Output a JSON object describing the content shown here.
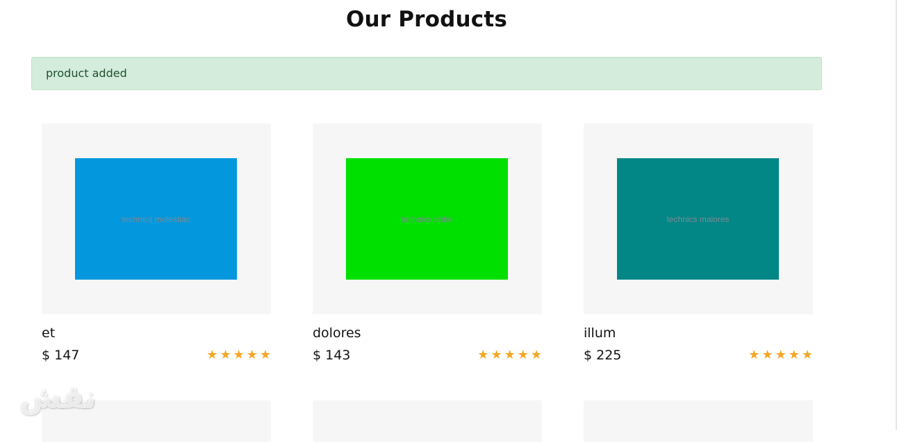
{
  "page": {
    "title": "Our Products"
  },
  "alert": {
    "message": "product added"
  },
  "products": [
    {
      "name": "et",
      "price": "$ 147",
      "image_text": "technics molestias",
      "image_color": "#0397dd",
      "rating": 5
    },
    {
      "name": "dolores",
      "price": "$ 143",
      "image_text": "technics dolor",
      "image_color": "#00e000",
      "rating": 5
    },
    {
      "name": "illum",
      "price": "$ 225",
      "image_text": "technics maiores",
      "image_color": "#038686",
      "rating": 5
    }
  ],
  "star_icon": "star-icon",
  "watermark": {
    "text": "ﻧﻘﺶ"
  }
}
